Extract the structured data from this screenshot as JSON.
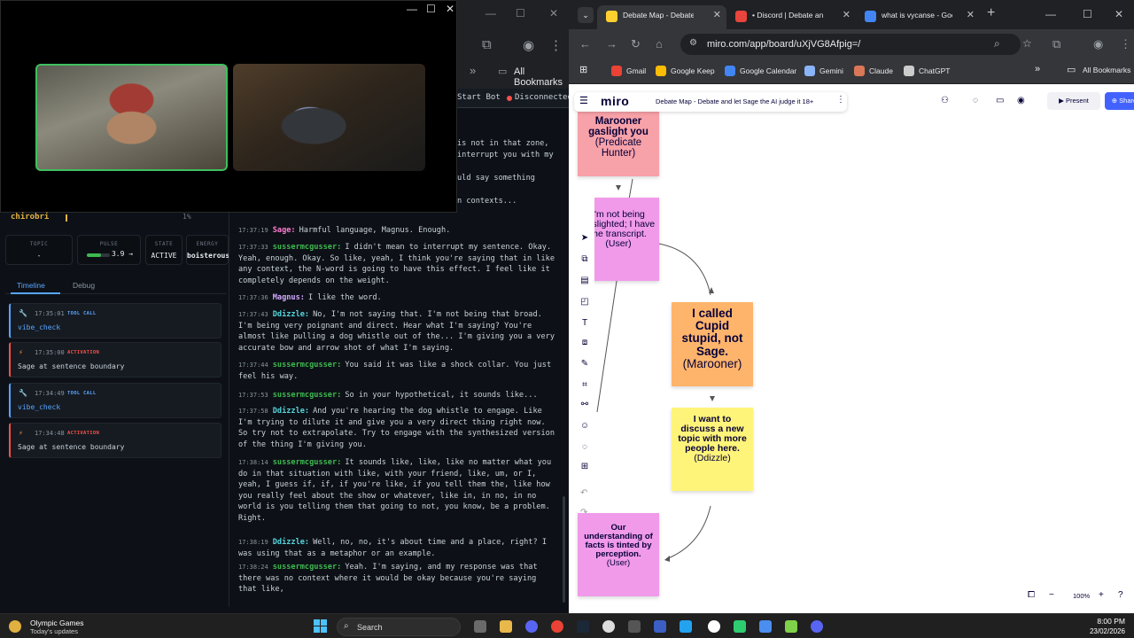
{
  "video_call": {
    "controls": [
      "—",
      "☐",
      "✕"
    ],
    "participants": [
      "participant-1",
      "participant-2"
    ]
  },
  "left_browser": {
    "controls": [
      "—",
      "☐",
      "✕"
    ],
    "bookmarks_label": "All Bookmarks"
  },
  "bot_bar": {
    "start_label": "Start Bot",
    "status": "Disconnected",
    "status_color": "#f85149"
  },
  "user_row": {
    "name": "chirobri",
    "percent": "1%"
  },
  "stats": [
    {
      "label": "TOPIC",
      "value": "-"
    },
    {
      "label": "PULSE",
      "value": "3.9 →",
      "fill": 0.6
    },
    {
      "label": "STATE",
      "value": "ACTIVE"
    },
    {
      "label": "ENERGY",
      "value": "boisterous"
    }
  ],
  "tabs": [
    "Timeline",
    "Debug"
  ],
  "timeline": [
    {
      "kind": "tool",
      "icon": "🔧",
      "time": "17:35:01",
      "type": "TOOL CALL",
      "name": "vibe_check"
    },
    {
      "kind": "act",
      "icon": "⚡",
      "time": "17:35:00",
      "type": "ACTIVATION",
      "name": "Sage at sentence boundary"
    },
    {
      "kind": "tool",
      "icon": "🔧",
      "time": "17:34:49",
      "type": "TOOL CALL",
      "name": "vibe_check"
    },
    {
      "kind": "act",
      "icon": "⚡",
      "time": "17:34:48",
      "type": "ACTIVATION",
      "name": "Sage at sentence boundary"
    }
  ],
  "transcript_prev": [
    "is not in that zone,",
    "interrupt you with my",
    "",
    "uld say something",
    "",
    "n contexts..."
  ],
  "transcript": [
    {
      "time": "17:37:19",
      "speaker": "Sage:",
      "cls": "sage",
      "text": "Harmful language, Magnus. Enough."
    },
    {
      "time": "17:37:33",
      "speaker": "sussermcgusser:",
      "cls": "suss",
      "text": "I didn't mean to interrupt my sentence. Okay. Yeah, enough. Okay. So like, yeah, I think you're saying that in like any context, the N-word is going to have this effect. I feel like it completely depends on the weight."
    },
    {
      "time": "17:37:36",
      "speaker": "Magnus:",
      "cls": "magnus",
      "text": "I like the word."
    },
    {
      "time": "17:37:43",
      "speaker": "Ddizzle:",
      "cls": "ddiz",
      "text": "No, I'm not saying that. I'm not being that broad. I'm being very poignant and direct. Hear what I'm saying? You're almost like pulling a dog whistle out of the... I'm giving you a very accurate bow and arrow shot of what I'm saying."
    },
    {
      "time": "17:37:44",
      "speaker": "sussermcgusser:",
      "cls": "suss",
      "text": "You said it was like a shock collar. You just feel his way."
    },
    {
      "time": "17:37:53",
      "speaker": "sussermcgusser:",
      "cls": "suss",
      "text": "So in your hypothetical, it sounds like..."
    },
    {
      "time": "17:37:58",
      "speaker": "Ddizzle:",
      "cls": "ddiz",
      "text": "And you're hearing the dog whistle to engage. Like I'm trying to dilute it and give you a very direct thing right now. So try not to extrapolate. Try to engage with the synthesized version of the thing I'm giving you."
    },
    {
      "time": "17:38:14",
      "speaker": "sussermcgusser:",
      "cls": "suss",
      "text": "It sounds like, like, like no matter what you do in that situation with like, with your friend, like, um, or I, yeah, I guess if, if, if you're like, if you tell them the, like how you really feel about the show or whatever, like in, in no, in no world is you telling them that going to not, you know, be a problem. Right."
    },
    {
      "time": "17:38:19",
      "speaker": "Ddizzle:",
      "cls": "ddiz",
      "text": "Well, no, no, it's about time and a place, right? I was using that as a metaphor or an example."
    },
    {
      "time": "17:38:24",
      "speaker": "sussermcgusser:",
      "cls": "suss",
      "text": "Yeah. I'm saying, and my response was that there was no context where it would be okay because you're saying that like,"
    }
  ],
  "chrome": {
    "tabs": [
      {
        "title": "Debate Map - Debate an",
        "color": "#ffd02f"
      },
      {
        "title": "• Discord | Debate and le",
        "color": "#e8453c"
      },
      {
        "title": "what is vycanse - Googl",
        "color": "#4285f4"
      }
    ],
    "url": "miro.com/app/board/uXjVG8Afpig=/",
    "bookmarks": [
      {
        "label": "Gmail",
        "color": "#ea4335"
      },
      {
        "label": "Google Keep",
        "color": "#fbbc04"
      },
      {
        "label": "Google Calendar",
        "color": "#4285f4"
      },
      {
        "label": "Gemini",
        "color": "#8ab4f8"
      },
      {
        "label": "Claude",
        "color": "#d97757"
      },
      {
        "label": "ChatGPT",
        "color": "#cccccc"
      }
    ],
    "all_bookmarks": "All Bookmarks"
  },
  "miro": {
    "logo": "miro",
    "board_title": "Debate Map - Debate and let Sage the AI judge it 18+",
    "present": "Present",
    "share": "Share",
    "zoom": "100%",
    "stickies": [
      {
        "head": "Marooner gaslight you",
        "author": "(Predicate Hunter)",
        "color": "#f7a1a8"
      },
      {
        "head": "I'm not being gaslighted; I have the transcript.",
        "author": "(User)",
        "color": "#f09ae9"
      },
      {
        "head": "I called Cupid stupid, not Sage.",
        "author": "(Marooner)",
        "color": "#ffb46b"
      },
      {
        "head": "I want to discuss a new topic with more people here.",
        "author": "(Ddizzle)",
        "color": "#fff47a"
      },
      {
        "head": "Our understanding of facts is tinted by perception.",
        "author": "(User)",
        "color": "#f09ae9"
      }
    ]
  },
  "taskbar": {
    "news_title": "Olympic Games",
    "news_sub": "Today's updates",
    "search": "Search",
    "time": "8:00 PM",
    "date": "23/02/2026"
  }
}
